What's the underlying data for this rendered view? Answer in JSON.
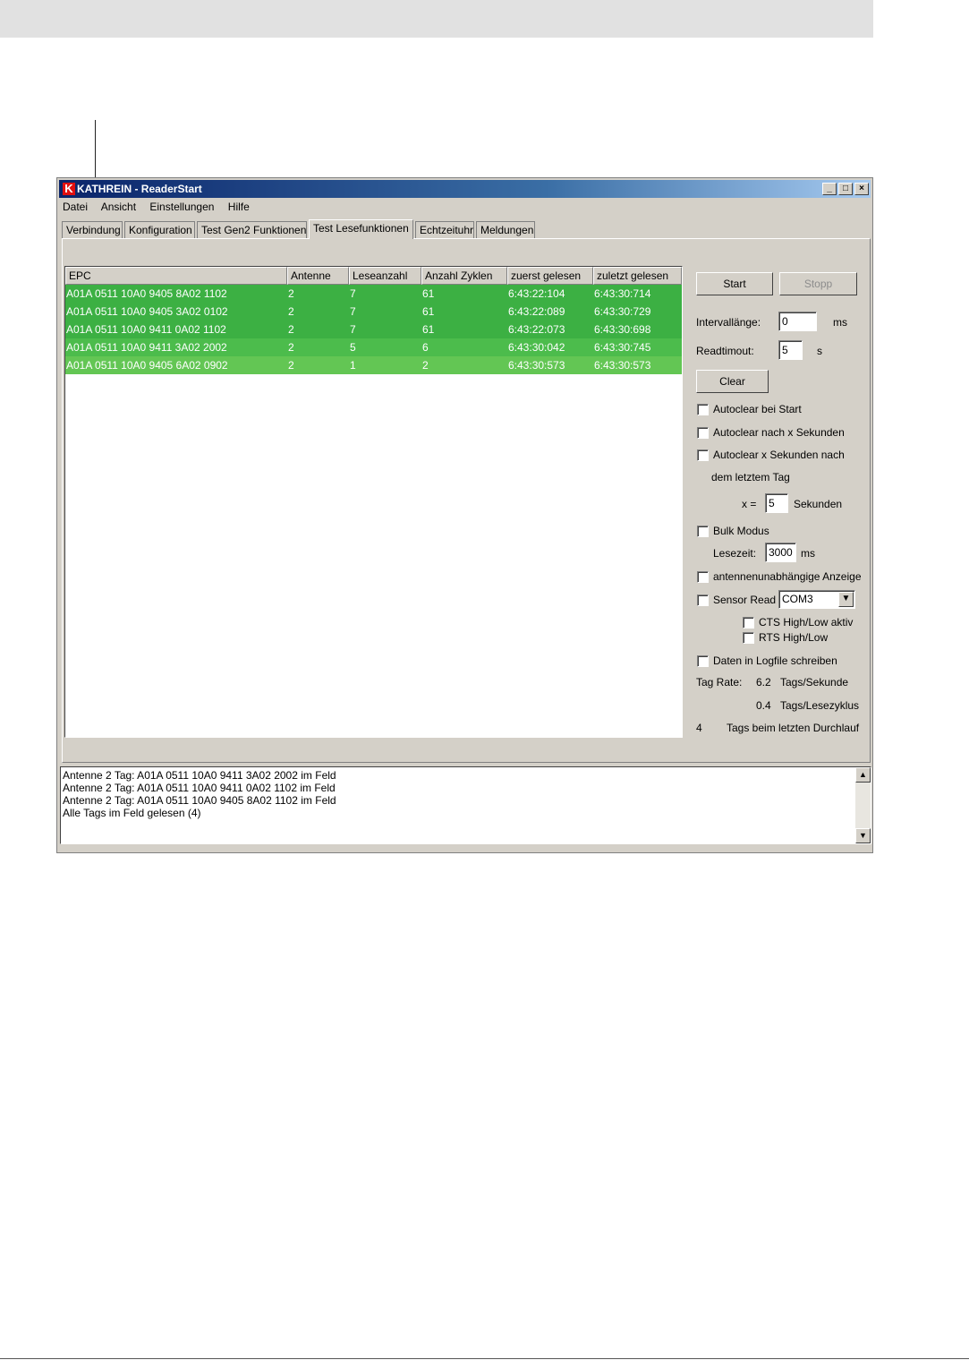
{
  "window": {
    "title": "KATHREIN - ReaderStart",
    "logo_letter": "K",
    "controls": {
      "minimize": "_",
      "maximize": "□",
      "close": "×"
    }
  },
  "menu": [
    "Datei",
    "Ansicht",
    "Einstellungen",
    "Hilfe"
  ],
  "tabs": [
    {
      "label": "Verbindung",
      "active": false
    },
    {
      "label": "Konfiguration",
      "active": false
    },
    {
      "label": "Test Gen2 Funktionen",
      "active": false
    },
    {
      "label": "Test Lesefunktionen",
      "active": true
    },
    {
      "label": "Echtzeituhr",
      "active": false
    },
    {
      "label": "Meldungen",
      "active": false
    }
  ],
  "table": {
    "columns": [
      "EPC",
      "Antenne",
      "Leseanzahl",
      "Anzahl Zyklen",
      "zuerst gelesen",
      "zuletzt gelesen"
    ],
    "rows": [
      {
        "epc": "A01A 0511 10A0 9405 8A02 1102",
        "antenne": "2",
        "leseanzahl": "7",
        "zyklen": "61",
        "zuerst": "6:43:22:104",
        "zuletzt": "6:43:30:714",
        "color": "#3cb043"
      },
      {
        "epc": "A01A 0511 10A0 9405 3A02 0102",
        "antenne": "2",
        "leseanzahl": "7",
        "zyklen": "61",
        "zuerst": "6:43:22:089",
        "zuletzt": "6:43:30:729",
        "color": "#3cb043"
      },
      {
        "epc": "A01A 0511 10A0 9411 0A02 1102",
        "antenne": "2",
        "leseanzahl": "7",
        "zyklen": "61",
        "zuerst": "6:43:22:073",
        "zuletzt": "6:43:30:698",
        "color": "#3cb043"
      },
      {
        "epc": "A01A 0511 10A0 9411 3A02 2002",
        "antenne": "2",
        "leseanzahl": "5",
        "zyklen": "6",
        "zuerst": "6:43:30:042",
        "zuletzt": "6:43:30:745",
        "color": "#4cbc4c"
      },
      {
        "epc": "A01A 0511 10A0 9405 6A02 0902",
        "antenne": "2",
        "leseanzahl": "1",
        "zyklen": "2",
        "zuerst": "6:43:30:573",
        "zuletzt": "6:43:30:573",
        "color": "#63c654"
      }
    ]
  },
  "side": {
    "start_label": "Start",
    "stopp_label": "Stopp",
    "interval_label": "Intervallänge:",
    "interval_value": "0",
    "interval_unit": "ms",
    "readtimeout_label": "Readtimout:",
    "readtimeout_value": "5",
    "readtimeout_unit": "s",
    "clear_label": "Clear",
    "autoclear_start": "Autoclear bei Start",
    "autoclear_x": "Autoclear nach x Sekunden",
    "autoclear_after": "Autoclear x Sekunden nach",
    "autoclear_after2": "dem letztem Tag",
    "x_label": "x =",
    "x_value": "5",
    "x_unit": "Sekunden",
    "bulk_label": "Bulk Modus",
    "lesezeit_label": "Lesezeit:",
    "lesezeit_value": "3000",
    "lesezeit_unit": "ms",
    "antenna_independent": "antennenunabhängige Anzeige",
    "sensor_read": "Sensor Read",
    "sensor_port": "COM3",
    "cts": "CTS High/Low aktiv",
    "rts": "RTS High/Low",
    "logfile": "Daten in Logfile schreiben",
    "tagrate_label": "Tag Rate:",
    "tagrate_sec_value": "6.2",
    "tagrate_sec_unit": "Tags/Sekunde",
    "tagrate_cycle_value": "0.4",
    "tagrate_cycle_unit": "Tags/Lesezyklus",
    "last_count": "4",
    "last_label": "Tags beim letzten Durchlauf"
  },
  "log": [
    "Antenne 2 Tag: A01A 0511 10A0 9411 3A02 2002 im Feld",
    "Antenne 2 Tag: A01A 0511 10A0 9411 0A02 1102 im Feld",
    "Antenne 2 Tag: A01A 0511 10A0 9405 8A02 1102 im Feld",
    "Alle Tags im Feld gelesen (4)"
  ]
}
